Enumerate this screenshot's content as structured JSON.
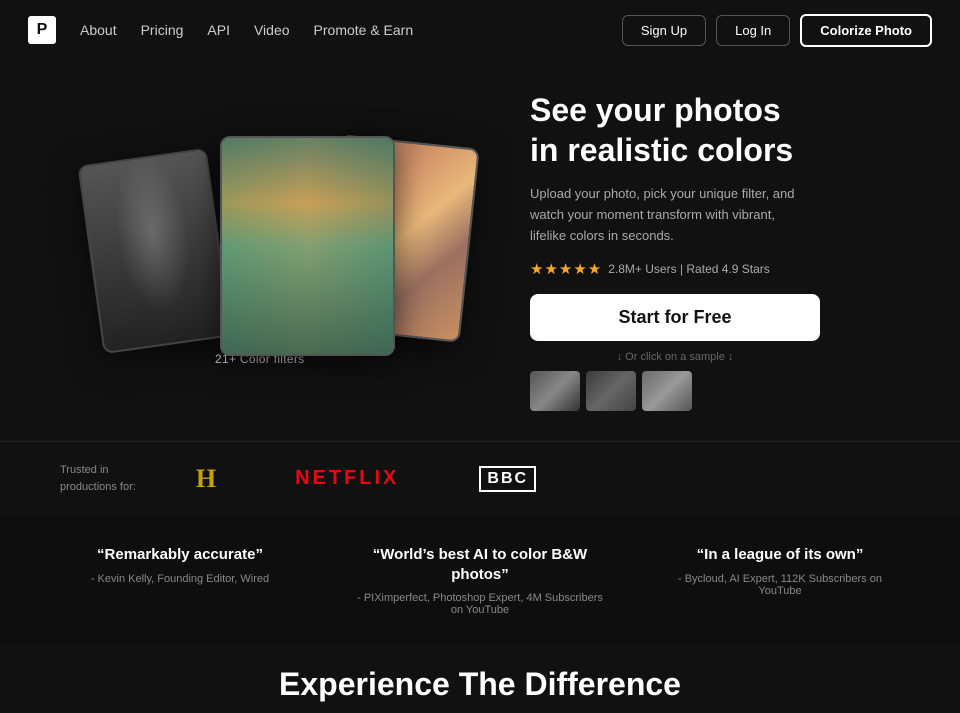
{
  "nav": {
    "logo": "P",
    "links": [
      {
        "label": "About",
        "href": "#"
      },
      {
        "label": "Pricing",
        "href": "#"
      },
      {
        "label": "API",
        "href": "#"
      },
      {
        "label": "Video",
        "href": "#"
      },
      {
        "label": "Promote & Earn",
        "href": "#"
      }
    ],
    "signup_label": "Sign Up",
    "login_label": "Log In",
    "colorize_label": "Colorize Photo"
  },
  "hero": {
    "title_line1": "See your photos",
    "title_line2": "in realistic colors",
    "description": "Upload your photo, pick your unique filter, and watch your moment transform with vibrant, lifelike colors in seconds.",
    "stars": "★★★★★",
    "rating_text": "2.8M+ Users | Rated 4.9 Stars",
    "cta_label": "Start for Free",
    "or_sample_text": "↓ Or click on a sample ↓",
    "filter_badge": "21+ Color filters"
  },
  "trusted": {
    "label_line1": "Trusted in",
    "label_line2": "productions for:",
    "brands": [
      {
        "name": "History Channel",
        "display": "H"
      },
      {
        "name": "Netflix",
        "display": "NETFLIX"
      },
      {
        "name": "BBC",
        "display": "BBC"
      }
    ]
  },
  "testimonials": [
    {
      "quote": "“Remarkably accurate”",
      "author": "- Kevin Kelly, Founding Editor, Wired"
    },
    {
      "quote": "“World’s best AI to color B&W photos”",
      "author": "- PIXimperfect, Photoshop Expert, 4M Subscribers on YouTube"
    },
    {
      "quote": "“In a league of its own”",
      "author": "- Bycloud, AI Expert, 112K Subscribers on YouTube"
    }
  ],
  "experience": {
    "title": "Experience The Difference"
  }
}
